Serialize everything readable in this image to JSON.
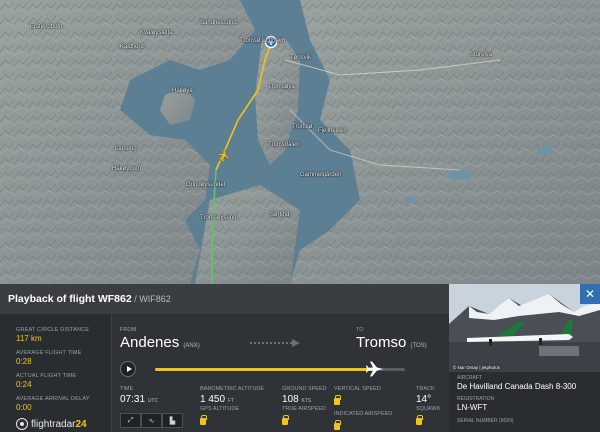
{
  "map": {
    "place_labels": [
      {
        "text": "Tromsø Lufthavn"
      },
      {
        "text": "Kvaløysletta"
      },
      {
        "text": "Kaldfjord"
      },
      {
        "text": "Håkøya"
      },
      {
        "text": "Tromsøya"
      },
      {
        "text": "Tromsø"
      },
      {
        "text": "Larseng"
      },
      {
        "text": "Håkøybotn"
      },
      {
        "text": "Grindøysundet"
      },
      {
        "text": "Tromsdalen"
      },
      {
        "text": "Fjellheisen"
      },
      {
        "text": "Sørtind"
      },
      {
        "text": "Tønsvik"
      },
      {
        "text": "Ersfjordbotn"
      },
      {
        "text": "Sandnessund"
      },
      {
        "text": "Storelva"
      },
      {
        "text": "Gammelgården"
      },
      {
        "text": "Tromsøysund"
      }
    ],
    "colors": {
      "water": "#5d7f93",
      "land": "#8e969a",
      "track": "#f0c419",
      "track_approach": "#59c86a"
    }
  },
  "panel": {
    "title": "Playback of flight WF862",
    "subtitle": " / WIF862"
  },
  "stats": [
    {
      "label": "Great circle distance",
      "value": "117 km"
    },
    {
      "label": "Average flight time",
      "value": "0:28"
    },
    {
      "label": "Actual flight time",
      "value": "0:24"
    },
    {
      "label": "Average arrival delay",
      "value": "0:00"
    }
  ],
  "brand": {
    "word": "flightradar",
    "num": "24"
  },
  "route": {
    "from_label": "From",
    "from_city": "Andenes",
    "from_iata": "(ANX)",
    "to_label": "To",
    "to_city": "Tromso",
    "to_iata": "(TOS)",
    "progress": 0.88
  },
  "metrics": {
    "time": {
      "label": "Time",
      "value": "07:31",
      "unit": "UTC"
    },
    "baro": {
      "label": "Barometric altitude",
      "value": "1 450",
      "unit": "FT",
      "sub": "GPS altitude"
    },
    "gs": {
      "label": "Ground speed",
      "value": "108",
      "unit": "KTS",
      "sub": "True airspeed"
    },
    "vs": {
      "label": "Vertical speed",
      "sub": "Indicated airspeed"
    },
    "track": {
      "label": "Track",
      "value": "14°",
      "sub": "Squawk"
    }
  },
  "tools": [
    "⤢",
    "∿",
    "▙"
  ],
  "aircraft": {
    "photo_credit": "© Nar Orsay | jetphotos",
    "aircraft_label": "Aircraft",
    "aircraft_value": "De Havilland Canada Dash 8-300",
    "reg_label": "Registration",
    "reg_value": "LN-WFT",
    "serial_label": "Serial number (MSN)"
  },
  "close": "✕"
}
